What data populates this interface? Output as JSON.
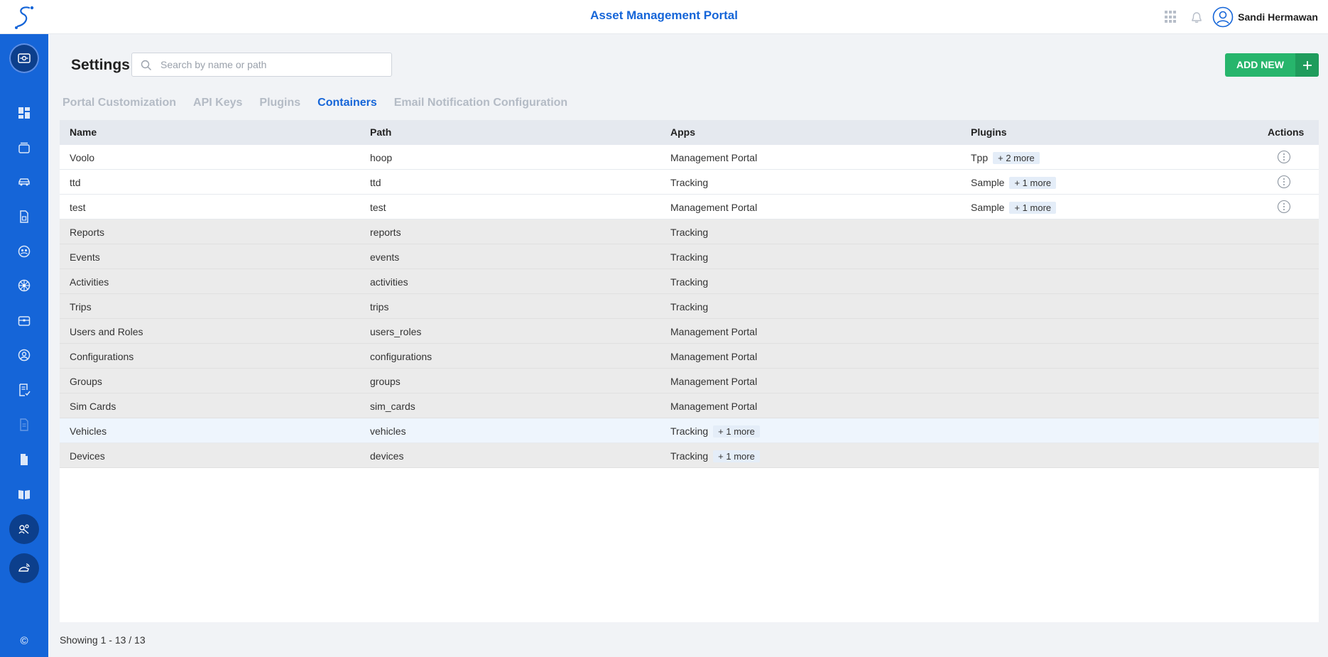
{
  "header": {
    "app_title": "Asset Management Portal",
    "user_name": "Sandi Hermawan"
  },
  "sidebar": {
    "items": [
      {
        "icon": "dashboard-icon"
      },
      {
        "icon": "layers-icon"
      },
      {
        "icon": "car-icon"
      },
      {
        "icon": "report-icon"
      },
      {
        "icon": "users-group-icon"
      },
      {
        "icon": "wheel-icon"
      },
      {
        "icon": "briefcase-icon"
      },
      {
        "icon": "user-circle-icon"
      },
      {
        "icon": "checklist-icon"
      },
      {
        "icon": "document-faded-icon"
      },
      {
        "icon": "file-icon"
      },
      {
        "icon": "book-icon"
      }
    ],
    "copyright": "©"
  },
  "page": {
    "title": "Settings",
    "search_placeholder": "Search by name or path",
    "add_new_label": "ADD NEW"
  },
  "tabs": [
    {
      "label": "Portal Customization",
      "active": false
    },
    {
      "label": "API Keys",
      "active": false
    },
    {
      "label": "Plugins",
      "active": false
    },
    {
      "label": "Containers",
      "active": true
    },
    {
      "label": "Email Notification Configuration",
      "active": false
    }
  ],
  "table": {
    "columns": [
      "Name",
      "Path",
      "Apps",
      "Plugins",
      "Actions"
    ],
    "rows": [
      {
        "name": "Voolo",
        "path": "hoop",
        "apps": "Management Portal",
        "apps_more": "",
        "plugins": "Tpp",
        "plugins_more": "+ 2 more",
        "has_action": true
      },
      {
        "name": "ttd",
        "path": "ttd",
        "apps": "Tracking",
        "apps_more": "",
        "plugins": "Sample",
        "plugins_more": "+ 1 more",
        "has_action": true
      },
      {
        "name": "test",
        "path": "test",
        "apps": "Management Portal",
        "apps_more": "",
        "plugins": "Sample",
        "plugins_more": "+ 1 more",
        "has_action": true
      },
      {
        "name": "Reports",
        "path": "reports",
        "apps": "Tracking",
        "apps_more": "",
        "plugins": "",
        "plugins_more": "",
        "has_action": false
      },
      {
        "name": "Events",
        "path": "events",
        "apps": "Tracking",
        "apps_more": "",
        "plugins": "",
        "plugins_more": "",
        "has_action": false
      },
      {
        "name": "Activities",
        "path": "activities",
        "apps": "Tracking",
        "apps_more": "",
        "plugins": "",
        "plugins_more": "",
        "has_action": false
      },
      {
        "name": "Trips",
        "path": "trips",
        "apps": "Tracking",
        "apps_more": "",
        "plugins": "",
        "plugins_more": "",
        "has_action": false
      },
      {
        "name": "Users and Roles",
        "path": "users_roles",
        "apps": "Management Portal",
        "apps_more": "",
        "plugins": "",
        "plugins_more": "",
        "has_action": false
      },
      {
        "name": "Configurations",
        "path": "configurations",
        "apps": "Management Portal",
        "apps_more": "",
        "plugins": "",
        "plugins_more": "",
        "has_action": false
      },
      {
        "name": "Groups",
        "path": "groups",
        "apps": "Management Portal",
        "apps_more": "",
        "plugins": "",
        "plugins_more": "",
        "has_action": false
      },
      {
        "name": "Sim Cards",
        "path": "sim_cards",
        "apps": "Management Portal",
        "apps_more": "",
        "plugins": "",
        "plugins_more": "",
        "has_action": false
      },
      {
        "name": "Vehicles",
        "path": "vehicles",
        "apps": "Tracking",
        "apps_more": "+ 1 more",
        "plugins": "",
        "plugins_more": "",
        "has_action": false
      },
      {
        "name": "Devices",
        "path": "devices",
        "apps": "Tracking",
        "apps_more": "+ 1 more",
        "plugins": "",
        "plugins_more": "",
        "has_action": false
      }
    ]
  },
  "footer": {
    "showing": "Showing 1 - 13 / 13"
  }
}
